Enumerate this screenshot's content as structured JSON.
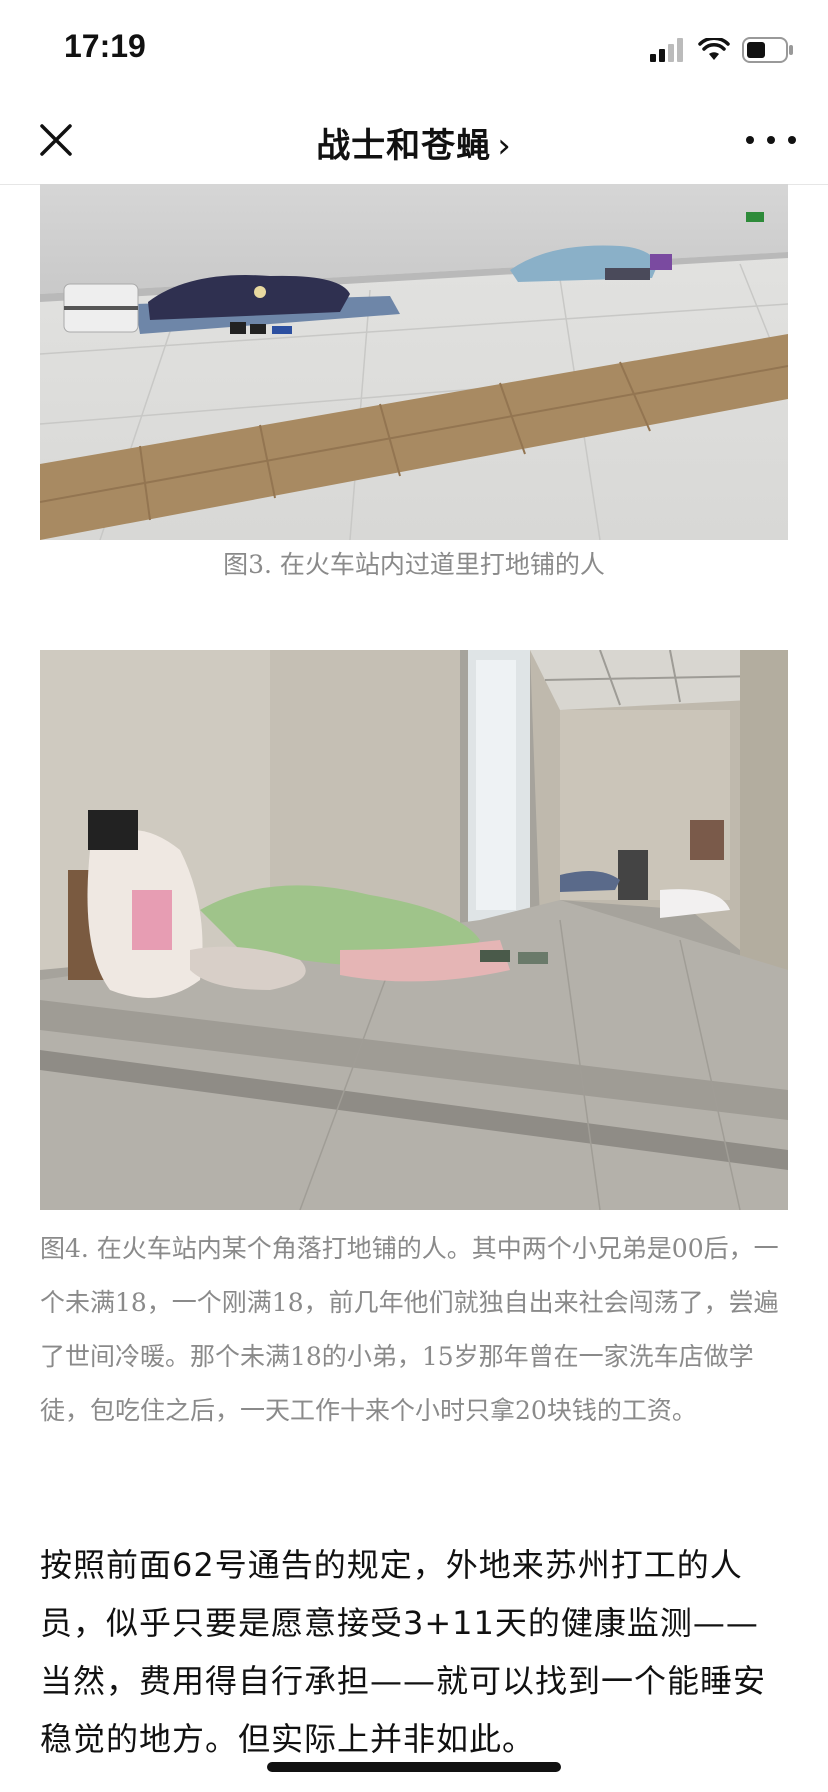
{
  "status": {
    "time": "17:19"
  },
  "nav": {
    "title": "战士和苍蝇",
    "chevron": "›"
  },
  "photos": [
    {
      "caption": "图3. 在火车站内过道里打地铺的人"
    },
    {
      "caption": "图4. 在火车站内某个角落打地铺的人。其中两个小兄弟是00后，一个未满18，一个刚满18，前几年他们就独自出来社会闯荡了，尝遍了世间冷暖。那个未满18的小弟，15岁那年曾在一家洗车店做学徒，包吃住之后，一天工作十来个小时只拿20块钱的工资。"
    }
  ],
  "article": {
    "paragraph": "按照前面62号通告的规定，外地来苏州打工的人员，似乎只要是愿意接受3+11天的健康监测——当然，费用得自行承担——就可以找到一个能睡安稳觉的地方。但实际上并非如此。"
  },
  "icons": {
    "signal": "signal-icon",
    "wifi": "wifi-icon",
    "battery": "battery-icon",
    "close": "close-icon",
    "more": "more-icon"
  }
}
